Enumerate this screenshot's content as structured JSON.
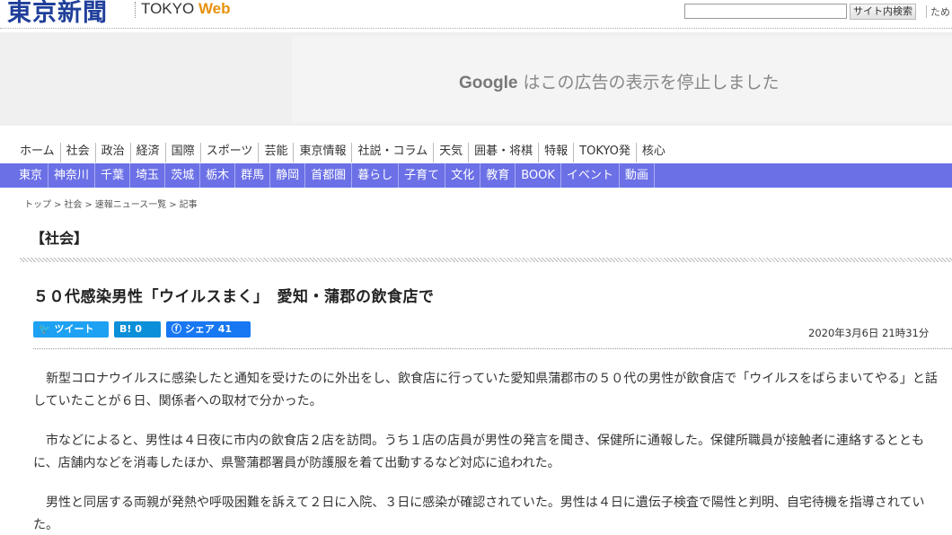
{
  "header": {
    "logo_jp": "東京新聞",
    "logo_en_tokyo": "TOKYO",
    "logo_en_web": "Web",
    "search_button": "サイト内検索",
    "header_link": "ため"
  },
  "ad": {
    "google": "Google",
    "message": "はこの広告の表示を停止しました"
  },
  "nav_primary": [
    "ホーム",
    "社会",
    "政治",
    "経済",
    "国際",
    "スポーツ",
    "芸能",
    "東京情報",
    "社説・コラム",
    "天気",
    "囲碁・将棋",
    "特報",
    "TOKYO発",
    "核心"
  ],
  "nav_secondary": [
    "東京",
    "神奈川",
    "千葉",
    "埼玉",
    "茨城",
    "栃木",
    "群馬",
    "静岡",
    "首都圏",
    "暮らし",
    "子育て",
    "文化",
    "教育",
    "BOOK",
    "イベント",
    "動画"
  ],
  "breadcrumb": {
    "top": "トップ",
    "society": "社会",
    "breaking": "速報ニュース一覧",
    "article": "記事",
    "separator": ">"
  },
  "section_title": "【社会】",
  "article": {
    "title": "５０代感染男性「ウイルスまく」　愛知・蒲郡の飲食店で",
    "date": "2020年3月6日 21時31分",
    "paragraphs": [
      "新型コロナウイルスに感染したと通知を受けたのに外出をし、飲食店に行っていた愛知県蒲郡市の５０代の男性が飲食店で「ウイルスをばらまいてやる」と話していたことが６日、関係者への取材で分かった。",
      "市などによると、男性は４日夜に市内の飲食店２店を訪問。うち１店の店員が男性の発言を聞き、保健所に通報した。保健所職員が接触者に連絡するとともに、店舗内などを消毒したほか、県警蒲郡署員が防護服を着て出動するなど対応に追われた。",
      "男性と同居する両親が発熱や呼吸困難を訴えて２日に入院、３日に感染が確認されていた。男性は４日に遺伝子検査で陽性と判明、自宅待機を指導されていた。"
    ]
  },
  "share": {
    "tweet": "ツイート",
    "hatena_label": "B!",
    "hatena_count": "0",
    "fb_label": "シェア",
    "fb_count": "41"
  }
}
